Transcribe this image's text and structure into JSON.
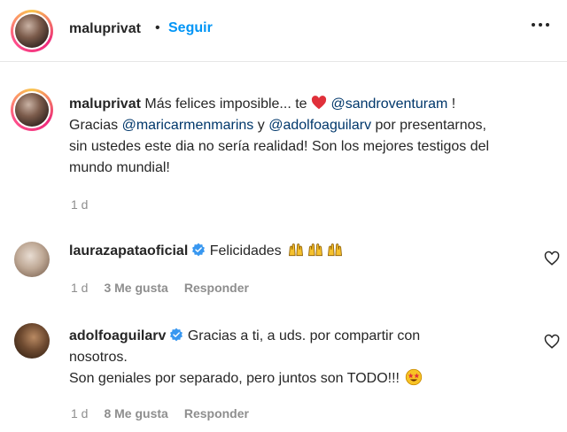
{
  "header": {
    "username": "maluprivat",
    "dot": "•",
    "follow_label": "Seguir"
  },
  "caption": {
    "username": "maluprivat",
    "text_1": "Más felices imposible... te",
    "mention_1": "@sandroventuram",
    "text_2": "!",
    "text_3": "Gracias",
    "mention_2": "@maricarmenmarins",
    "text_4": "y",
    "mention_3": "@adolfoaguilarv",
    "text_5": "por presentarnos,",
    "line_3": "sin ustedes este dia no sería realidad! Son los mejores testigos del",
    "line_4": "mundo mundial!",
    "time": "1 d"
  },
  "comments": [
    {
      "username": "laurazapataoficial",
      "text": "Felicidades",
      "time": "1 d",
      "likes": "3 Me gusta",
      "reply": "Responder"
    },
    {
      "username": "adolfoaguilarv",
      "text_line_1": "Gracias a ti, a uds. por compartir con",
      "text_line_2": "nosotros.",
      "text_line_3": "Son geniales por separado, pero juntos son TODO!!!",
      "time": "1 d",
      "likes": "8 Me gusta",
      "reply": "Responder"
    }
  ],
  "colors": {
    "accent": "#0095f6",
    "mention": "#00376b",
    "muted": "#8e8e8e",
    "verified": "#3897f0",
    "heart": "#ed4956"
  },
  "icons": [
    "more-options-icon",
    "red-heart-icon",
    "verified-badge-icon",
    "raised-hands-emoji-icon",
    "star-struck-emoji-icon",
    "like-heart-icon"
  ]
}
